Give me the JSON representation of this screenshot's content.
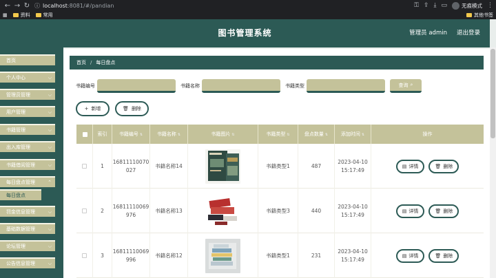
{
  "browser": {
    "url_host": "localhost",
    "url_path": ":8081/#/pandian",
    "incognito_label": "无痕模式",
    "bookmarks": [
      "资料",
      "常用"
    ],
    "other_bookmarks": "其他书签"
  },
  "header": {
    "title": "图书管理系统",
    "user": "管理员 admin",
    "logout": "退出登录"
  },
  "sidebar": {
    "items": [
      {
        "label": "首页",
        "has_chevron": false
      },
      {
        "label": "个人中心",
        "has_chevron": true
      },
      {
        "label": "管理员管理",
        "has_chevron": true
      },
      {
        "label": "用户管理",
        "has_chevron": true
      },
      {
        "label": "书籍管理",
        "has_chevron": true
      },
      {
        "label": "出入库管理",
        "has_chevron": true
      },
      {
        "label": "书籍借阅管理",
        "has_chevron": true
      },
      {
        "label": "每日盘点管理",
        "has_chevron": true
      },
      {
        "label": "罚金信息管理",
        "has_chevron": true
      },
      {
        "label": "基础数据管理",
        "has_chevron": true
      },
      {
        "label": "论坛管理",
        "has_chevron": true
      },
      {
        "label": "公告信息管理",
        "has_chevron": true
      }
    ],
    "submenu_label": "每日盘点"
  },
  "breadcrumb": {
    "home": "首页",
    "separator": "/",
    "current": "每日盘点"
  },
  "search": {
    "fields": [
      {
        "label": "书籍编号",
        "value": ""
      },
      {
        "label": "书籍名称",
        "value": ""
      },
      {
        "label": "书籍类型",
        "value": ""
      }
    ],
    "query_label": "查询"
  },
  "actions": {
    "add_label": "新增",
    "delete_label": "删除"
  },
  "table": {
    "headers": [
      "索引",
      "书籍编号",
      "书籍名称",
      "书籍图片",
      "书籍类型",
      "盘点数量",
      "添加时间",
      "操作"
    ],
    "rows": [
      {
        "index": "1",
        "code_1": "16811110070",
        "code_2": "027",
        "name": "书籍名称14",
        "type": "书籍类型1",
        "count": "487",
        "date": "2023-04-10",
        "time": "15:17:49",
        "image": "book-cover-dark-green"
      },
      {
        "index": "2",
        "code_1": "16811110069",
        "code_2": "976",
        "name": "书籍名称13",
        "type": "书籍类型3",
        "count": "440",
        "date": "2023-04-10",
        "time": "15:17:49",
        "image": "book-stack-red"
      },
      {
        "index": "3",
        "code_1": "16811110069",
        "code_2": "996",
        "name": "书籍名称12",
        "type": "书籍类型1",
        "count": "231",
        "date": "2023-04-10",
        "time": "15:17:49",
        "image": "book-pile-photo"
      }
    ],
    "detail_label": "详情",
    "delete_label": "删除"
  },
  "colors": {
    "primary": "#2c5a55",
    "accent": "#c4c29a"
  }
}
